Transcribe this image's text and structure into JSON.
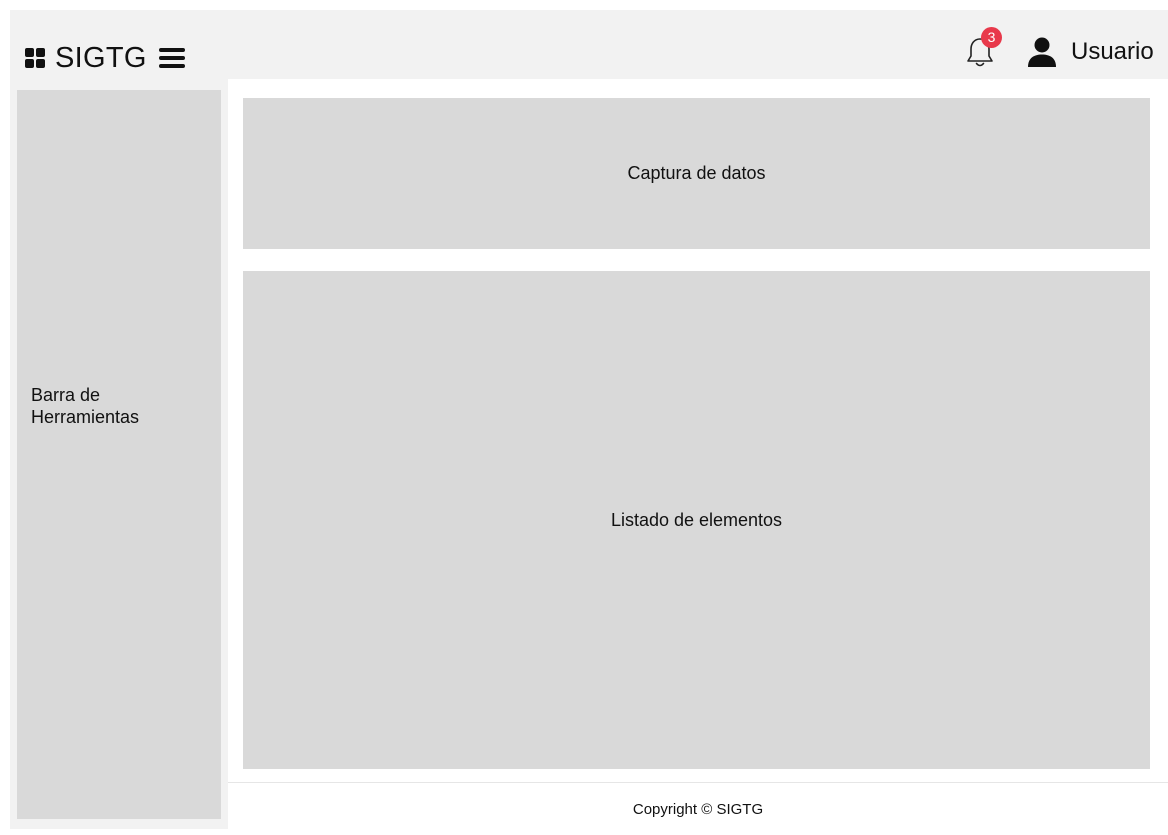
{
  "header": {
    "brand": "SIGTG",
    "brand_icon": "grid-icon",
    "menu_icon": "hamburger-menu-icon",
    "notifications": {
      "icon": "bell-icon",
      "count": "3",
      "badge_color": "#e8394b"
    },
    "user": {
      "icon": "user-icon",
      "name": "Usuario"
    }
  },
  "sidebar": {
    "label_line1": "Barra de",
    "label_line2": "Herramientas"
  },
  "main": {
    "capture_panel": "Captura de datos",
    "list_panel": "Listado de elementos"
  },
  "footer": {
    "copyright": "Copyright © SIGTG"
  },
  "colors": {
    "topbar": "#f2f2f2",
    "placeholder": "#d9d9d9"
  }
}
